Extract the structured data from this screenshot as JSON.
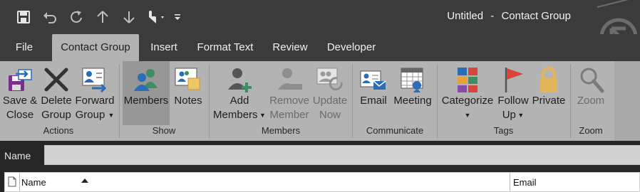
{
  "window": {
    "doc_name": "Untitled",
    "separator": "-",
    "context": "Contact Group"
  },
  "quick_access": [
    {
      "icon": "save-icon"
    },
    {
      "icon": "undo-icon"
    },
    {
      "icon": "redo-icon"
    },
    {
      "icon": "arrow-up-icon"
    },
    {
      "icon": "arrow-down-icon"
    },
    {
      "icon": "touch-mode-icon"
    },
    {
      "icon": "customize-qat-icon"
    }
  ],
  "tabs": [
    {
      "label": "File"
    },
    {
      "label": "Contact Group",
      "active": true
    },
    {
      "label": "Insert"
    },
    {
      "label": "Format Text"
    },
    {
      "label": "Review"
    },
    {
      "label": "Developer"
    }
  ],
  "ribbon": {
    "actions": {
      "group_label": "Actions",
      "save_close": {
        "line1": "Save &",
        "line2": "Close"
      },
      "delete_group": {
        "line1": "Delete",
        "line2": "Group"
      },
      "forward_group": {
        "line1": "Forward",
        "line2": "Group"
      }
    },
    "show": {
      "group_label": "Show",
      "members": "Members",
      "notes": "Notes"
    },
    "members": {
      "group_label": "Members",
      "add_members": {
        "line1": "Add",
        "line2": "Members"
      },
      "remove_member": {
        "line1": "Remove",
        "line2": "Member"
      },
      "update_now": {
        "line1": "Update",
        "line2": "Now"
      }
    },
    "communicate": {
      "group_label": "Communicate",
      "email": "Email",
      "meeting": "Meeting"
    },
    "tags": {
      "group_label": "Tags",
      "categorize": "Categorize",
      "follow_up": {
        "line1": "Follow",
        "line2": "Up"
      },
      "private": "Private"
    },
    "zoom": {
      "group_label": "Zoom",
      "zoom": "Zoom"
    }
  },
  "name_field": {
    "label": "Name",
    "value": ""
  },
  "members_list": {
    "columns": [
      {
        "label": "Name",
        "sorted": "ascending"
      },
      {
        "label": "Email"
      }
    ]
  },
  "colors": {
    "titlebar": "#3b3b3b",
    "ribbon": "#b3b3b3",
    "selected": "#979797",
    "accent_blue": "#2a6db5",
    "accent_green": "#3e8e63",
    "lock_gold": "#e3b55a",
    "flag_red": "#d9453b"
  }
}
